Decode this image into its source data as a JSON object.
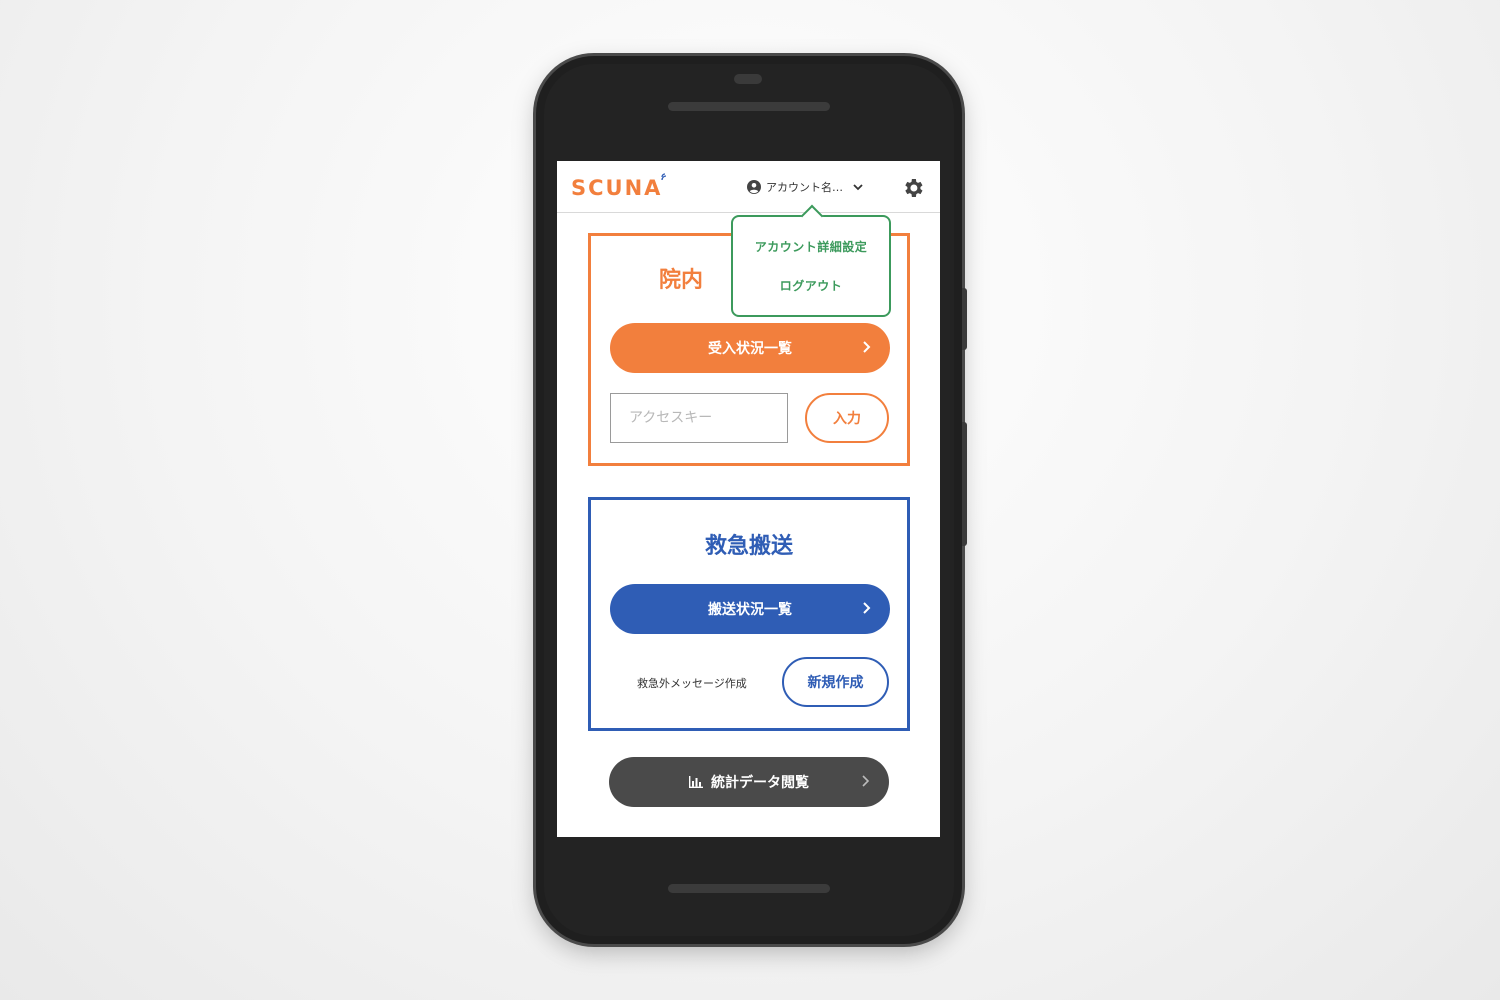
{
  "header": {
    "logo_text": "SCUNA",
    "account_name": "アカウント名…",
    "icons": {
      "account": "account-circle-icon",
      "chevron": "chevron-down-icon",
      "settings": "gear-icon"
    }
  },
  "account_menu": {
    "items": [
      {
        "label": "アカウント詳細設定"
      },
      {
        "label": "ログアウト"
      }
    ]
  },
  "hospital_card": {
    "title": "院内",
    "list_button_label": "受入状況一覧",
    "access_key_placeholder": "アクセスキー",
    "access_key_value": "",
    "enter_button_label": "入力"
  },
  "ems_card": {
    "title": "救急搬送",
    "list_button_label": "搬送状況一覧",
    "message_label": "救急外メッセージ作成",
    "new_button_label": "新規作成"
  },
  "stats_button": {
    "label": "統計データ閲覧"
  },
  "colors": {
    "orange": "#f27f3d",
    "blue": "#2f5db5",
    "green": "#3c9a5c",
    "dark_gray": "#4a4a4a"
  }
}
